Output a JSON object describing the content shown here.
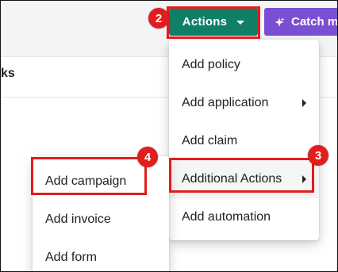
{
  "header": {
    "actions_label": "Actions",
    "catch_label": "Catch m"
  },
  "card": {
    "title_fragment": "ks"
  },
  "menus": {
    "primary": [
      {
        "label": "Add policy",
        "has_submenu": false
      },
      {
        "label": "Add application",
        "has_submenu": true
      },
      {
        "label": "Add claim",
        "has_submenu": false
      },
      {
        "label": "Additional Actions",
        "has_submenu": true
      },
      {
        "label": "Add automation",
        "has_submenu": false
      }
    ],
    "secondary": [
      {
        "label": "Add campaign"
      },
      {
        "label": "Add invoice"
      },
      {
        "label": "Add form"
      }
    ]
  },
  "annotations": {
    "step2": "2",
    "step3": "3",
    "step4": "4"
  },
  "colors": {
    "actions_button": "#0f7f67",
    "catch_button": "#7b4fd3",
    "highlight": "#e11d1d"
  },
  "icons": {
    "actions_caret": "caret-down-icon",
    "catch_sparkle": "sparkle-icon",
    "submenu_arrow": "chevron-right-icon"
  }
}
